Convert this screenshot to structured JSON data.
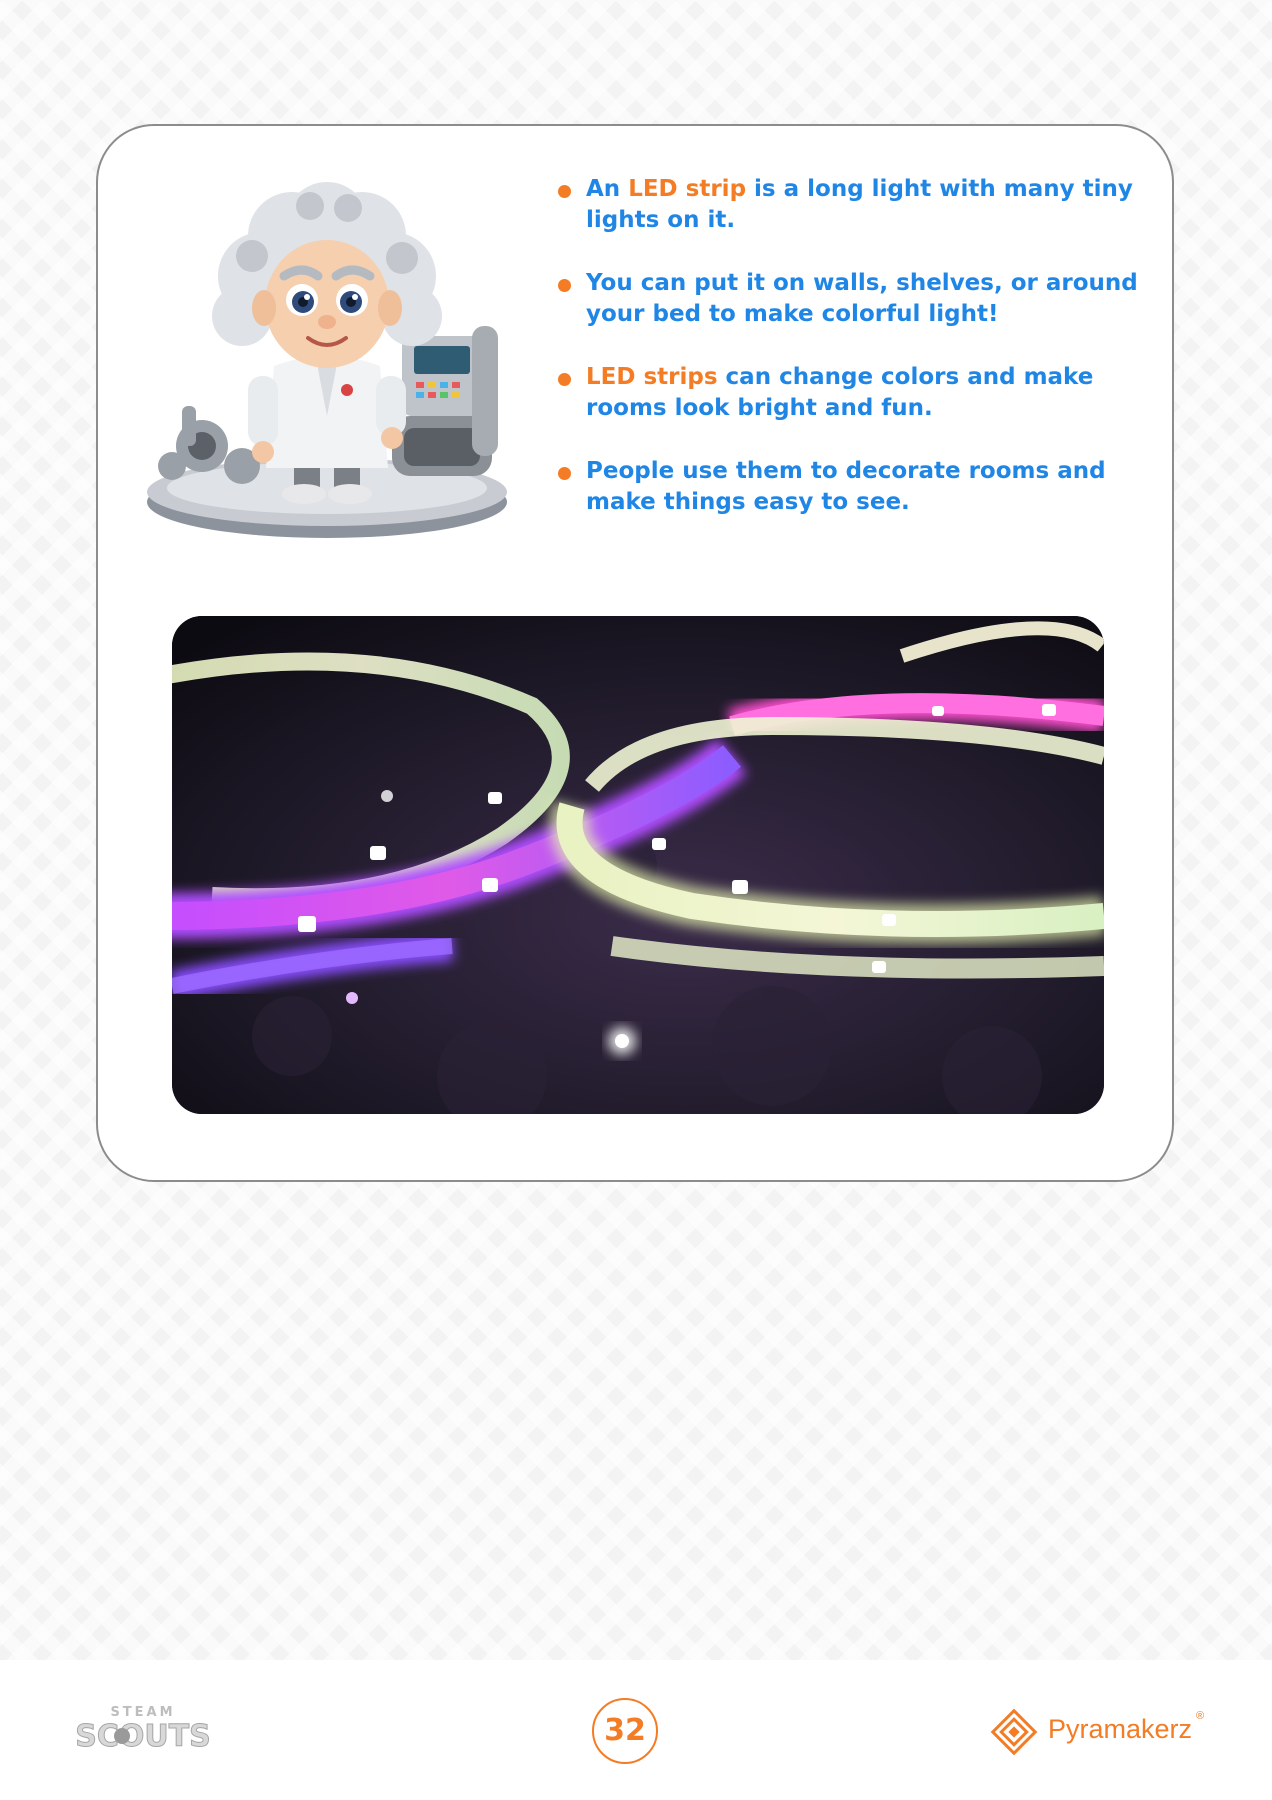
{
  "facts": [
    {
      "pre": "An ",
      "highlight": "LED strip",
      "post": " is a long light with many tiny lights on it."
    },
    {
      "pre": "You can put it on walls, shelves, or around your bed to make colorful light!",
      "highlight": "",
      "post": ""
    },
    {
      "pre": "",
      "highlight": "LED strips",
      "post": " can change colors and make rooms look bright and fun."
    },
    {
      "pre": "People use them to decorate rooms and make things easy to see.",
      "highlight": "",
      "post": ""
    }
  ],
  "footer": {
    "steam_logo": {
      "top": "STEAM",
      "bottom": "SCOUTS"
    },
    "page_number": "32",
    "brand": {
      "name": "Pyramakerz",
      "reg": "®"
    }
  },
  "colors": {
    "text_blue": "#1f86e6",
    "accent_orange": "#f37c25"
  },
  "icons": {
    "mascot": "scientist-mascot-illustration",
    "photo": "led-strip-photo",
    "brand_mark": "pyramid-diamond-icon"
  }
}
